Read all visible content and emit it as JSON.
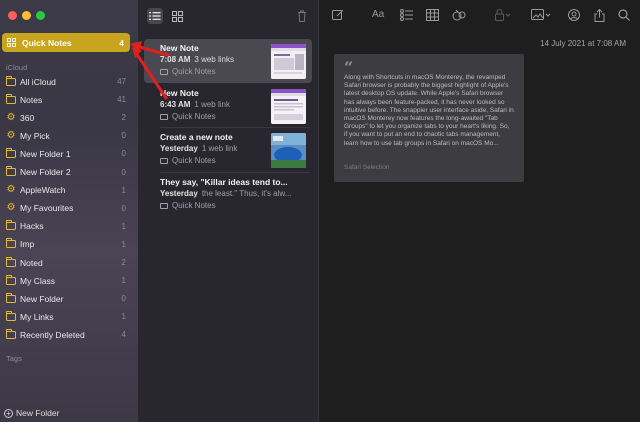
{
  "sidebar": {
    "quick_notes": {
      "label": "Quick Notes",
      "count": "4"
    },
    "icloud_header": "iCloud",
    "items": [
      {
        "label": "All iCloud",
        "count": "47",
        "icon": "folder"
      },
      {
        "label": "Notes",
        "count": "41",
        "icon": "folder"
      },
      {
        "label": "360",
        "count": "2",
        "icon": "smart-folder"
      },
      {
        "label": "My Pick",
        "count": "0",
        "icon": "smart-folder"
      },
      {
        "label": "New Folder 1",
        "count": "0",
        "icon": "folder"
      },
      {
        "label": "New Folder 2",
        "count": "0",
        "icon": "folder"
      },
      {
        "label": "AppleWatch",
        "count": "1",
        "icon": "smart-folder"
      },
      {
        "label": "My Favourites",
        "count": "0",
        "icon": "smart-folder"
      },
      {
        "label": "Hacks",
        "count": "1",
        "icon": "folder"
      },
      {
        "label": "Imp",
        "count": "1",
        "icon": "folder"
      },
      {
        "label": "Noted",
        "count": "2",
        "icon": "folder"
      },
      {
        "label": "My Class",
        "count": "1",
        "icon": "folder"
      },
      {
        "label": "New Folder",
        "count": "0",
        "icon": "folder"
      },
      {
        "label": "My Links",
        "count": "1",
        "icon": "folder"
      },
      {
        "label": "Recently Deleted",
        "count": "4",
        "icon": "folder"
      }
    ],
    "tags_header": "Tags",
    "new_folder_label": "New Folder"
  },
  "notes": [
    {
      "title": "New Note",
      "time": "7:08 AM",
      "sub": "3 web links",
      "folder": "Quick Notes"
    },
    {
      "title": "New Note",
      "time": "6:43 AM",
      "sub": "1 web link",
      "folder": "Quick Notes"
    },
    {
      "title": "Create a new note",
      "time": "Yesterday",
      "sub": "1 web link",
      "folder": "Quick Notes"
    },
    {
      "title": "They say, \"Killar ideas tend to...",
      "time": "Yesterday",
      "sub": "the least.\" Thus, it's alw...",
      "folder": "Quick Notes"
    }
  ],
  "editor": {
    "date": "14 July 2021 at 7:08 AM",
    "quote_mark": "“",
    "quote_text": "Along with Shortcuts in macOS Monterey, the revamped Safari browser is probably the biggest highlight of Apple's latest desktop OS update. While Apple's Safari browser has always been feature-packed, it has never looked so intuitive before. The snappier user interface aside, Safari in macOS Monterey now features the long-awaited \"Tab Groups\" to let you organize tabs to your heart's liking. So, if you want to put an end to chaotic tabs management, learn how to use tab groups in Safari on macOS Mo...",
    "caption": "Safari Selection"
  },
  "colors": {
    "accent": "#c9a51e",
    "arrow": "#e0201c",
    "folder_icon": "#e4b830"
  }
}
